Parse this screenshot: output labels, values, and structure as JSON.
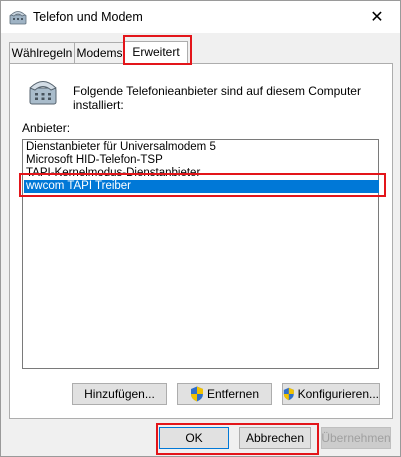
{
  "window": {
    "title": "Telefon und Modem",
    "close_glyph": "✕"
  },
  "tabs": [
    {
      "label": "Wählregeln"
    },
    {
      "label": "Modems"
    },
    {
      "label": "Erweitert"
    }
  ],
  "panel": {
    "description": "Folgende Telefonieanbieter sind auf diesem Computer installiert:",
    "list_label": "Anbieter:",
    "providers": [
      "Dienstanbieter für Universalmodem 5",
      "Microsoft HID-Telefon-TSP",
      "TAPI-Kernelmodus-Dienstanbieter",
      "wwcom TAPI Treiber"
    ],
    "selected_provider": "wwcom TAPI Treiber"
  },
  "panel_buttons": {
    "add": "Hinzufügen...",
    "remove": "Entfernen",
    "configure": "Konfigurieren..."
  },
  "dialog_buttons": {
    "ok": "OK",
    "cancel": "Abbrechen",
    "apply": "Übernehmen"
  },
  "colors": {
    "selection": "#0078d7",
    "highlight_annotation": "#e3151a"
  },
  "icons": [
    "phone-modem-icon",
    "uac-shield-icon",
    "close-icon"
  ]
}
